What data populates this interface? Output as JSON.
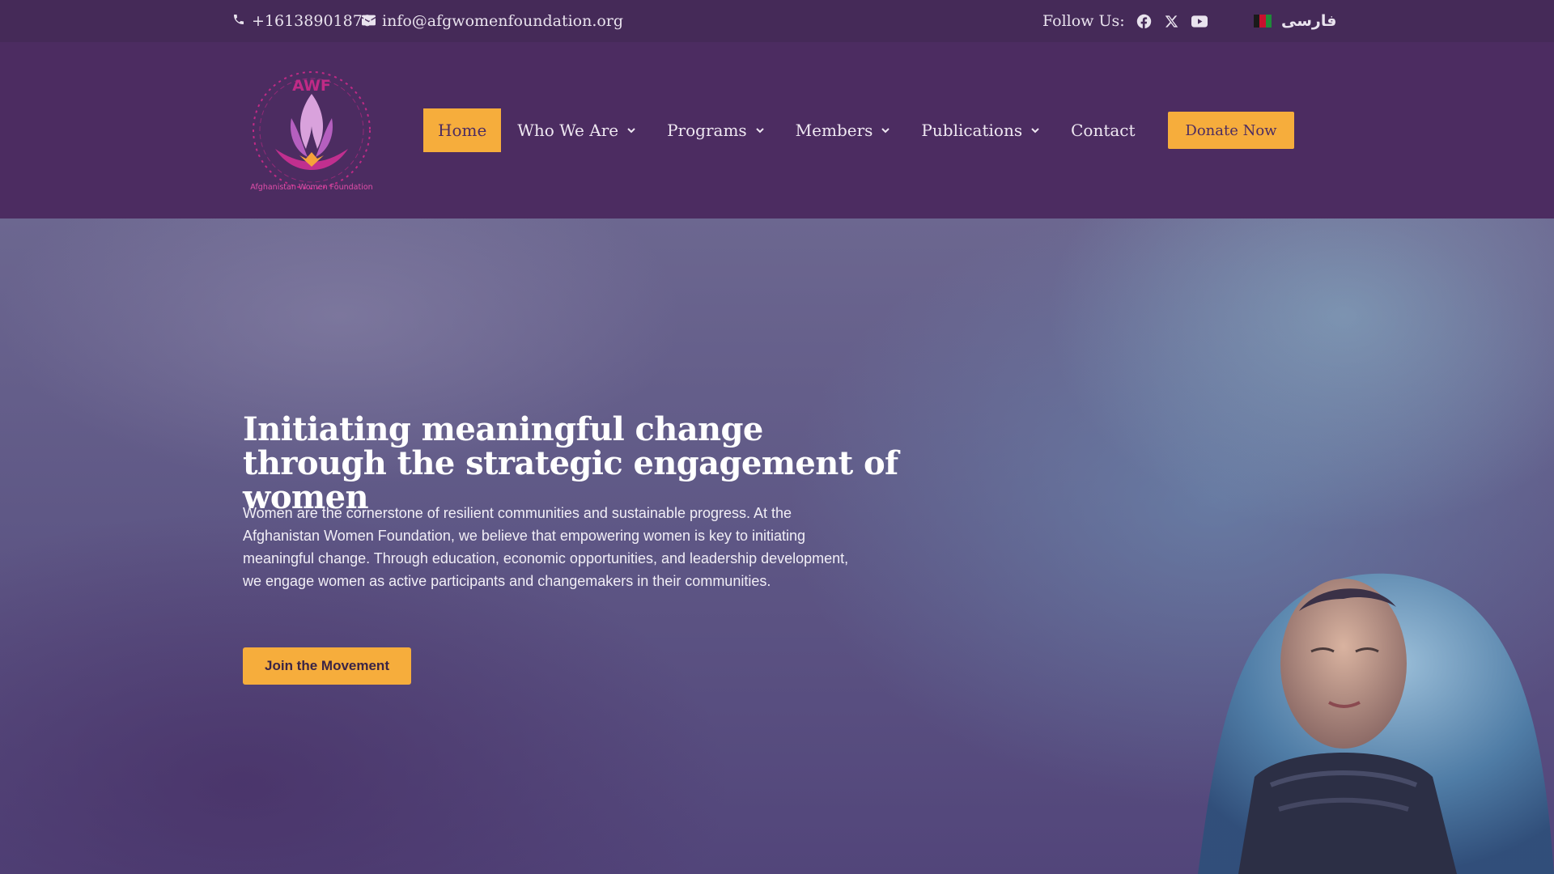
{
  "topbar": {
    "phone": "+16138901870",
    "email": "info@afgwomenfoundation.org",
    "follow_label": "Follow Us:",
    "social": [
      "facebook-icon",
      "x-icon",
      "youtube-icon"
    ],
    "language": "فارسی"
  },
  "logo": {
    "acronym": "AWF",
    "name": "Afghanistan Women Foundation"
  },
  "nav": {
    "items": [
      {
        "label": "Home",
        "active": true
      },
      {
        "label": "Who We Are",
        "dropdown": true
      },
      {
        "label": "Programs",
        "dropdown": true
      },
      {
        "label": "Members",
        "dropdown": true
      },
      {
        "label": "Publications",
        "dropdown": true
      },
      {
        "label": "Contact"
      }
    ],
    "donate_label": "Donate Now"
  },
  "hero": {
    "title": "Initiating meaningful change through the strategic engagement of women",
    "body": "Women are the cornerstone of resilient communities and sustainable progress. At the Afghanistan Women Foundation, we believe that empowering women is key to initiating meaningful change. Through education, economic opportunities, and leadership development, we engage women as active participants and changemakers in their communities.",
    "cta_label": "Join the Movement"
  },
  "colors": {
    "brand_purple": "#4c2c61",
    "topbar": "#452a58",
    "accent": "#f6ad3c"
  }
}
